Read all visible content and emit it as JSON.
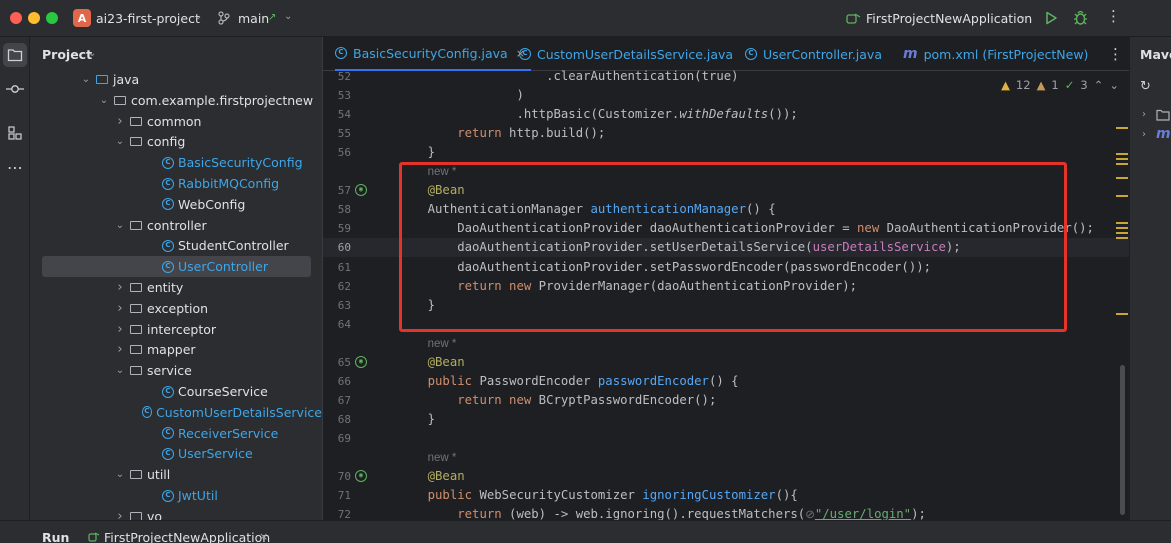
{
  "titlebar": {
    "project_initial": "A",
    "project_name": "ai23-first-project",
    "branch_icon": "branch-icon",
    "branch": "main",
    "branch_arrow": "↗",
    "run_config": "FirstProjectNewApplication"
  },
  "toolstrip": {
    "icons": [
      "folder-icon",
      "commit-icon",
      "structure-icon",
      "more-icon"
    ]
  },
  "project_panel": {
    "title": "Project",
    "tree": [
      {
        "label": "java",
        "kind": "folder",
        "depth": 0,
        "expanded": true
      },
      {
        "label": "com.example.firstprojectnew",
        "kind": "package",
        "depth": 1,
        "expanded": true
      },
      {
        "label": "common",
        "kind": "package",
        "depth": 2,
        "expanded": false
      },
      {
        "label": "config",
        "kind": "package",
        "depth": 2,
        "expanded": true
      },
      {
        "label": "BasicSecurityConfig",
        "kind": "class",
        "depth": 3,
        "modified": true
      },
      {
        "label": "RabbitMQConfig",
        "kind": "class",
        "depth": 3,
        "modified": true
      },
      {
        "label": "WebConfig",
        "kind": "class",
        "depth": 3,
        "modified": false
      },
      {
        "label": "controller",
        "kind": "package",
        "depth": 2,
        "expanded": true
      },
      {
        "label": "StudentController",
        "kind": "class",
        "depth": 3,
        "modified": false
      },
      {
        "label": "UserController",
        "kind": "class",
        "depth": 3,
        "modified": true,
        "selected": true
      },
      {
        "label": "entity",
        "kind": "package",
        "depth": 2,
        "expanded": false
      },
      {
        "label": "exception",
        "kind": "package",
        "depth": 2,
        "expanded": false
      },
      {
        "label": "interceptor",
        "kind": "package",
        "depth": 2,
        "expanded": false
      },
      {
        "label": "mapper",
        "kind": "package",
        "depth": 2,
        "expanded": false
      },
      {
        "label": "service",
        "kind": "package",
        "depth": 2,
        "expanded": true
      },
      {
        "label": "CourseService",
        "kind": "class",
        "depth": 3,
        "modified": false
      },
      {
        "label": "CustomUserDetailsService",
        "kind": "class",
        "depth": 3,
        "modified": true
      },
      {
        "label": "ReceiverService",
        "kind": "class",
        "depth": 3,
        "modified": true
      },
      {
        "label": "UserService",
        "kind": "class",
        "depth": 3,
        "modified": true
      },
      {
        "label": "utill",
        "kind": "package",
        "depth": 2,
        "expanded": true
      },
      {
        "label": "JwtUtil",
        "kind": "class",
        "depth": 3,
        "modified": true
      },
      {
        "label": "vo",
        "kind": "package",
        "depth": 2,
        "expanded": false
      }
    ]
  },
  "tabs": [
    {
      "label": "BasicSecurityConfig.java",
      "active": true,
      "icon": "C"
    },
    {
      "label": "CustomUserDetailsService.java",
      "active": false,
      "icon": "C"
    },
    {
      "label": "UserController.java",
      "active": false,
      "icon": "C"
    },
    {
      "label": "pom.xml (FirstProjectNew)",
      "active": false,
      "icon": "m"
    }
  ],
  "inspections": {
    "warnings": "12",
    "weak_warnings": "1",
    "ok": "3"
  },
  "code_lines": [
    {
      "num": "52",
      "html": "                    .clearAuthentication(true)"
    },
    {
      "num": "53",
      "html": "                )"
    },
    {
      "num": "54",
      "html": "                .httpBasic(Customizer.<span class=\"it\">withDefaults</span>());"
    },
    {
      "num": "55",
      "html": "        <span class=\"kw\">return</span> http.build();"
    },
    {
      "num": "56",
      "html": "    }"
    },
    {
      "num": "",
      "html": "    <span class=\"hint\">new *</span>",
      "hint": true
    },
    {
      "num": "57",
      "html": "    <span class=\"ann\">@Bean</span>",
      "bean": true
    },
    {
      "num": "58",
      "html": "    AuthenticationManager <span class=\"fn\">authenticationManager</span>() {"
    },
    {
      "num": "59",
      "html": "        DaoAuthenticationProvider daoAuthenticationProvider = <span class=\"kw\">new</span> DaoAuthenticationProvider();"
    },
    {
      "num": "60",
      "html": "        daoAuthenticationProvider.setUserDetailsService(<span class=\"fld\">userDetailsService</span>);",
      "current": true
    },
    {
      "num": "61",
      "html": "        daoAuthenticationProvider.setPasswordEncoder(passwordEncoder());"
    },
    {
      "num": "62",
      "html": "        <span class=\"kw\">return new</span> ProviderManager(daoAuthenticationProvider);"
    },
    {
      "num": "63",
      "html": "    }"
    },
    {
      "num": "64",
      "html": ""
    },
    {
      "num": "",
      "html": "    <span class=\"hint\">new *</span>",
      "hint": true
    },
    {
      "num": "65",
      "html": "    <span class=\"ann\">@Bean</span>",
      "bean": true
    },
    {
      "num": "66",
      "html": "    <span class=\"kw\">public</span> PasswordEncoder <span class=\"fn\">passwordEncoder</span>() {"
    },
    {
      "num": "67",
      "html": "        <span class=\"kw\">return new</span> BCryptPasswordEncoder();"
    },
    {
      "num": "68",
      "html": "    }"
    },
    {
      "num": "69",
      "html": ""
    },
    {
      "num": "",
      "html": "    <span class=\"hint\">new *</span>",
      "hint": true
    },
    {
      "num": "70",
      "html": "    <span class=\"ann\">@Bean</span>",
      "bean": true
    },
    {
      "num": "71",
      "html": "    <span class=\"kw\">public</span> WebSecurityCustomizer <span class=\"fn\">ignoringCustomizer</span>(){"
    },
    {
      "num": "72",
      "html": "        <span class=\"kw\">return</span> (web) -> web.ignoring().requestMatchers(<span class=\"hint\">⊘</span><span class=\"str\">\"/user/login\"</span>);"
    }
  ],
  "maven": {
    "title": "Maven",
    "items": [
      "refresh-icon",
      "folder-icon",
      "maven-module-icon"
    ]
  },
  "bottom": {
    "run_label": "Run",
    "run_tab": "FirstProjectNewApplication"
  },
  "colors": {
    "accent": "#3574f0",
    "highlight_box": "#e5332a",
    "modified_file": "#3ea6e8"
  }
}
